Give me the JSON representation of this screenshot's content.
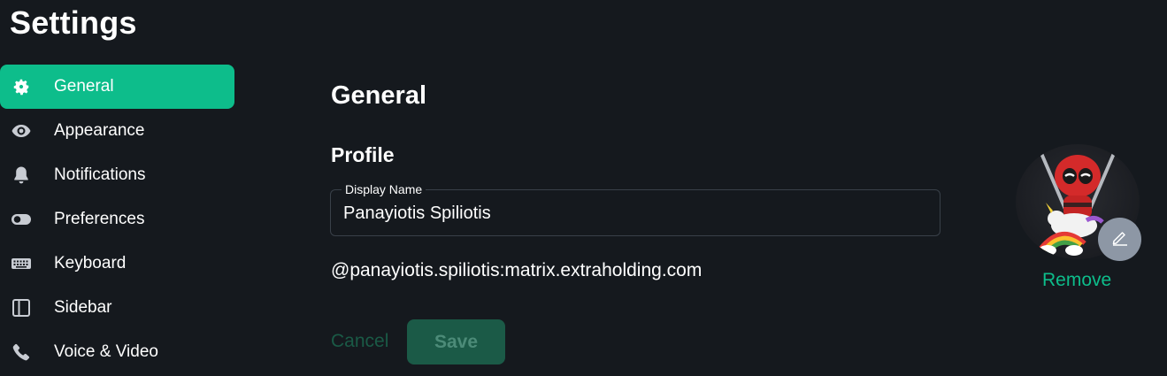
{
  "header": {
    "title": "Settings"
  },
  "sidebar": {
    "items": [
      {
        "label": "General",
        "icon": "gear-icon",
        "active": true
      },
      {
        "label": "Appearance",
        "icon": "eye-icon",
        "active": false
      },
      {
        "label": "Notifications",
        "icon": "bell-icon",
        "active": false
      },
      {
        "label": "Preferences",
        "icon": "toggle-icon",
        "active": false
      },
      {
        "label": "Keyboard",
        "icon": "keyboard-icon",
        "active": false
      },
      {
        "label": "Sidebar",
        "icon": "sidebar-layout-icon",
        "active": false
      },
      {
        "label": "Voice & Video",
        "icon": "phone-icon",
        "active": false
      }
    ]
  },
  "main": {
    "section_title": "General",
    "profile": {
      "heading": "Profile",
      "display_name_label": "Display Name",
      "display_name_value": "Panayiotis Spiliotis",
      "user_id": "@panayiotis.spiliotis:matrix.extraholding.com",
      "avatar": {
        "edit_icon": "pencil-icon",
        "remove_label": "Remove"
      }
    },
    "actions": {
      "cancel_label": "Cancel",
      "save_label": "Save"
    }
  },
  "colors": {
    "background": "#15191e",
    "accent": "#0dbd8b",
    "disabled_button": "#1b5a47",
    "field_border": "#394049"
  }
}
